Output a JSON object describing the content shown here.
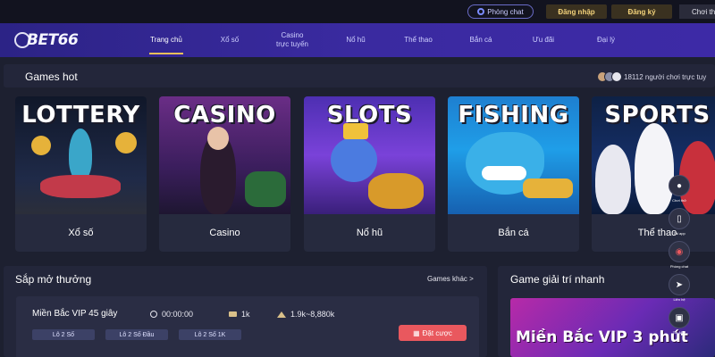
{
  "topbar": {
    "chat_label": "Phòng chat",
    "login_label": "Đăng nhập",
    "register_label": "Đăng ký",
    "try_label": "Chơi thử"
  },
  "nav": {
    "logo": "BET66",
    "items": [
      {
        "label": "Trang chủ",
        "active": true
      },
      {
        "label": "Xổ số"
      },
      {
        "label": "Casino\ntrực tuyến"
      },
      {
        "label": "Nổ hũ"
      },
      {
        "label": "Thể thao"
      },
      {
        "label": "Bắn cá"
      },
      {
        "label": "Ưu đãi"
      },
      {
        "label": "Đại lý"
      }
    ]
  },
  "games_hot": {
    "title": "Games hot",
    "online_text": "18112 người chơi trực tuy",
    "cards": [
      {
        "art_title": "LOTTERY",
        "name": "Xổ số"
      },
      {
        "art_title": "CASINO",
        "name": "Casino"
      },
      {
        "art_title": "SLOTS",
        "name": "Nổ hũ"
      },
      {
        "art_title": "FISHING",
        "name": "Bắn cá"
      },
      {
        "art_title": "SPORTS",
        "name": "Thể thao"
      }
    ]
  },
  "upcoming": {
    "title": "Sắp mở thưởng",
    "more_label": "Games khác >",
    "row": {
      "name": "Miền Bắc VIP 45 giây",
      "time": "00:00:00",
      "bet": "1k",
      "prize": "1.9k~8,880k",
      "tags": [
        "Lô 2 Số",
        "Lô 2 Số Đầu",
        "Lô 2 Số 1K"
      ],
      "bet_button": "Đặt cược"
    }
  },
  "quick_games": {
    "title": "Game giải trí nhanh",
    "banner_text": "Miền Bắc VIP 3 phút"
  },
  "side_menu": [
    {
      "label": "Chơi thử",
      "icon": "user-icon"
    },
    {
      "label": "Tải app",
      "icon": "phone-icon"
    },
    {
      "label": "Phòng chat",
      "icon": "chat-icon"
    },
    {
      "label": "Liên hệ",
      "icon": "send-icon"
    },
    {
      "label": "Tải APP",
      "icon": "app-icon"
    },
    {
      "label": "",
      "icon": "top-icon"
    }
  ],
  "colors": {
    "accent_gold": "#e9c05a",
    "nav_purple": "#3a2aa0",
    "bet_red": "#e9585e",
    "panel_bg": "#23263a"
  }
}
